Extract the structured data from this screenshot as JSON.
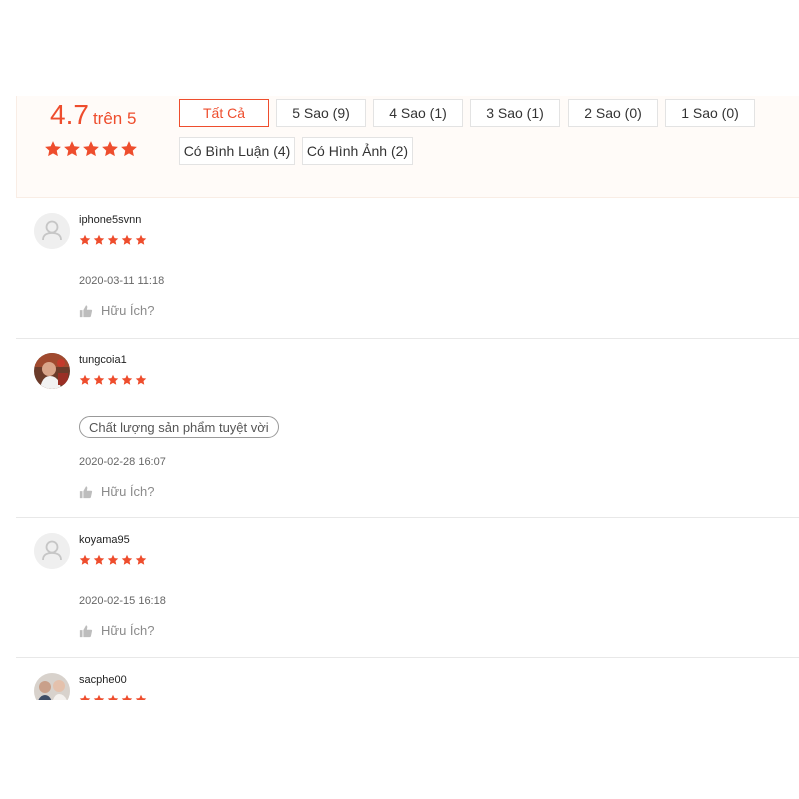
{
  "colors": {
    "accent": "#ee4d2d",
    "summary_bg": "#fffbf8"
  },
  "summary": {
    "score": "4.7",
    "score_suffix": "trên 5",
    "stars": 5,
    "filters": [
      {
        "label": "Tất Cả",
        "active": true
      },
      {
        "label": "5 Sao (9)",
        "active": false
      },
      {
        "label": "4 Sao (1)",
        "active": false
      },
      {
        "label": "3 Sao (1)",
        "active": false
      },
      {
        "label": "2 Sao (0)",
        "active": false
      },
      {
        "label": "1 Sao (0)",
        "active": false
      },
      {
        "label": "Có Bình Luận (4)",
        "active": false
      },
      {
        "label": "Có Hình Ảnh (2)",
        "active": false
      }
    ]
  },
  "reviews": [
    {
      "username": "iphone5svnn",
      "rating": 5,
      "avatar": "default-avatar",
      "time": "2020-03-11 11:18",
      "helpful_label": "Hữu Ích?"
    },
    {
      "username": "tungcoia1",
      "rating": 5,
      "avatar": "photo-avatar",
      "tag": "Chất lượng sản phẩm tuyệt vời",
      "time": "2020-02-28 16:07",
      "helpful_label": "Hữu Ích?"
    },
    {
      "username": "koyama95",
      "rating": 5,
      "avatar": "default-avatar",
      "time": "2020-02-15 16:18",
      "helpful_label": "Hữu Ích?"
    },
    {
      "username": "sacphe00",
      "rating": 5,
      "avatar": "photo-avatar"
    }
  ]
}
